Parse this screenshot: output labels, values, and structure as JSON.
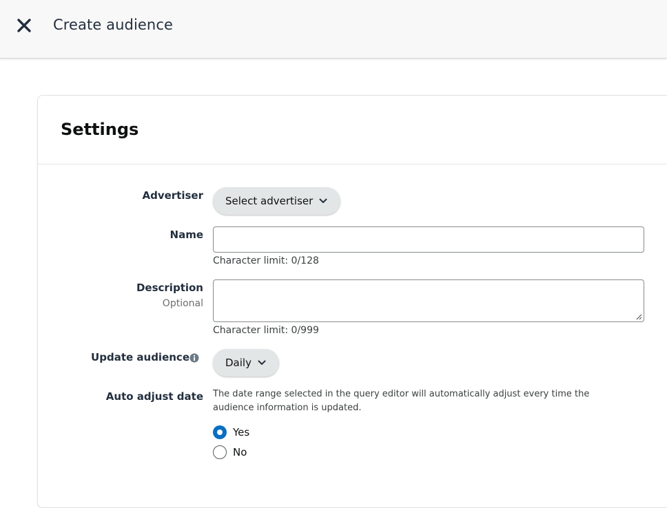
{
  "header": {
    "close_icon": "close-icon",
    "title": "Create audience"
  },
  "settings": {
    "title": "Settings",
    "advertiser": {
      "label": "Advertiser",
      "button_label": "Select advertiser"
    },
    "name": {
      "label": "Name",
      "value": "",
      "hint": "Character limit: 0/128"
    },
    "description": {
      "label": "Description",
      "sublabel": "Optional",
      "value": "",
      "hint": "Character limit: 0/999"
    },
    "update_audience": {
      "label": "Update audience",
      "icon": "info-icon",
      "selected": "Daily"
    },
    "auto_adjust_date": {
      "label": "Auto adjust date",
      "description": "The date range selected in the query editor will automatically adjust every time the audience information is updated.",
      "options": [
        {
          "label": "Yes",
          "checked": true
        },
        {
          "label": "No",
          "checked": false
        }
      ]
    }
  },
  "colors": {
    "accent": "#0a6fc2",
    "topbar_bg": "#f8f8f8",
    "pill_bg": "#e3e6e6"
  }
}
